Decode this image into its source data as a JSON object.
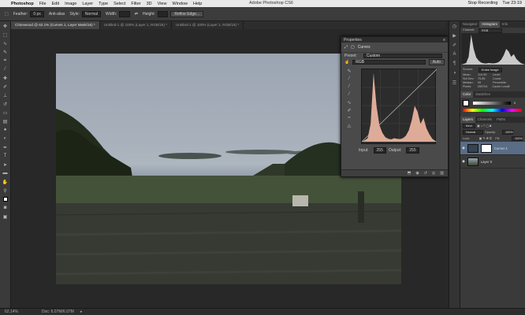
{
  "menubar": {
    "apple": "",
    "app": "Photoshop",
    "items": [
      "File",
      "Edit",
      "Image",
      "Layer",
      "Type",
      "Select",
      "Filter",
      "3D",
      "View",
      "Window",
      "Help"
    ],
    "window_title": "Adobe Photoshop CS6",
    "status": [
      "Stop Recording",
      "Tue 23:19"
    ]
  },
  "options": {
    "feather_label": "Feather:",
    "feather_value": "0 px",
    "antialias_label": "Anti-alias",
    "style_label": "Style:",
    "style_value": "Normal",
    "width_label": "Width:",
    "height_label": "Height:",
    "refine_label": "Refine Edge..."
  },
  "tabs": [
    "Chinnwood @ 62.1% (Curves 1, Layer Mask/16) *",
    "Untitled-1 @ 100% (Layer 1, RGB/16) *",
    "Untitled-1 @ 100% (Layer 1, RGB/16) *"
  ],
  "properties": {
    "header": "Properties",
    "title": "Curves",
    "preset_label": "Preset:",
    "preset_value": "Custom",
    "channel_value": "RGB",
    "auto_label": "Auto",
    "input_label": "Input:",
    "input_value": "255",
    "output_label": "Output:",
    "output_value": "255"
  },
  "histogram": {
    "tabs": [
      "Navigator",
      "Histogram",
      "Info"
    ],
    "channel_label": "Channel:",
    "channel_value": "RGB",
    "source_label": "Source:",
    "source_value": "Entire Image",
    "stats": [
      [
        "Mean:",
        "110.99",
        "Level:",
        ""
      ],
      [
        "Std Dev:",
        "75.85",
        "Count:",
        ""
      ],
      [
        "Median:",
        "99",
        "Percentile:",
        ""
      ],
      [
        "Pixels:",
        "259704",
        "Cache Level:",
        "2"
      ]
    ]
  },
  "color": {
    "tabs": [
      "Color",
      "Swatches"
    ],
    "k_value": "0"
  },
  "layers": {
    "tabs": [
      "Layers",
      "Channels",
      "Paths"
    ],
    "kind_label": "Kind",
    "blend_value": "Normal",
    "opacity_label": "Opacity:",
    "opacity_value": "100%",
    "lock_label": "Lock:",
    "fill_label": "Fill:",
    "fill_value": "100%",
    "items": [
      {
        "name": "Curves 1"
      },
      {
        "name": "Layer 0"
      }
    ]
  },
  "status": {
    "zoom": "62.14%",
    "doc": "Doc: 6.07M/6.07M"
  },
  "colors": {
    "accent": "#5a6d86",
    "curve_fill": "#f2b9a4"
  },
  "chart_data": {
    "type": "area",
    "title": "",
    "x": [
      0,
      10,
      20,
      30,
      40,
      50,
      60,
      70,
      80,
      90,
      100,
      110,
      120,
      130,
      140,
      150,
      160,
      170,
      180,
      190,
      200,
      210,
      220,
      230,
      240,
      250,
      255
    ],
    "values": [
      0,
      5,
      12,
      60,
      230,
      120,
      55,
      30,
      15,
      10,
      8,
      12,
      10,
      9,
      12,
      20,
      38,
      72,
      120,
      100,
      60,
      80,
      45,
      25,
      10,
      3,
      0
    ],
    "xlim": [
      0,
      255
    ]
  }
}
